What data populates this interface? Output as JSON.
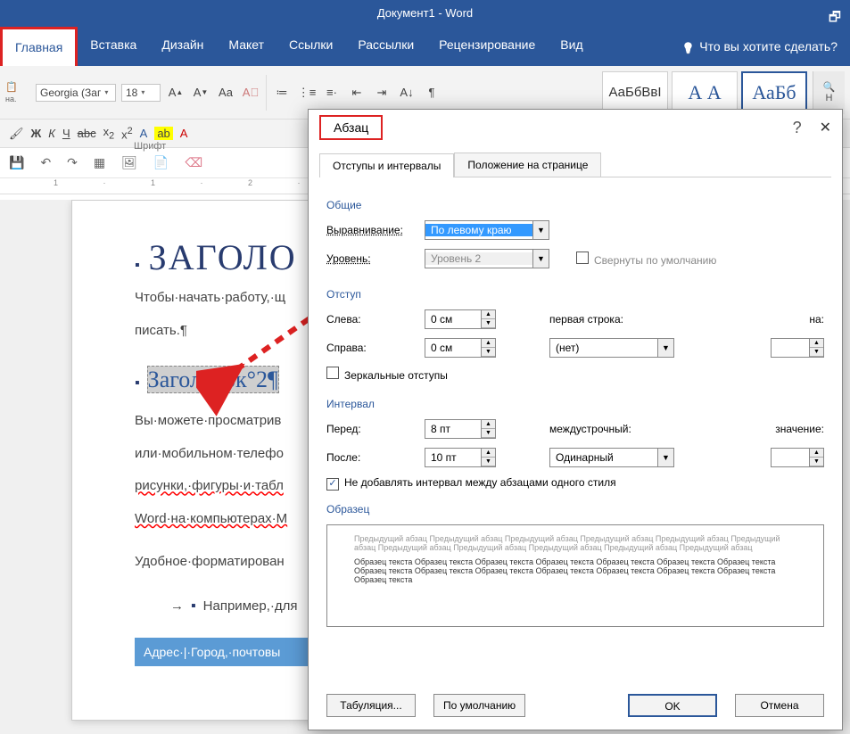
{
  "app": {
    "title": "Документ1 - Word"
  },
  "ribbon": {
    "tabs": [
      "Главная",
      "Вставка",
      "Дизайн",
      "Макет",
      "Ссылки",
      "Рассылки",
      "Рецензирование",
      "Вид"
    ],
    "tellme": "Что вы хотите сделать?",
    "font_name": "Georgia (Заг",
    "font_size": "18",
    "group_font": "Шрифт",
    "styles": {
      "normal": "АаБбВвІ",
      "h1": "А А",
      "h2": "АаБб"
    },
    "right": "Н"
  },
  "dialog": {
    "title": "Абзац",
    "tab1": "Отступы и интервалы",
    "tab2": "Положение на странице",
    "general": "Общие",
    "align_lbl": "Выравнивание:",
    "align_val": "По левому краю",
    "level_lbl": "Уровень:",
    "level_val": "Уровень 2",
    "collapse": "Свернуты по умолчанию",
    "indent": "Отступ",
    "left_lbl": "Слева:",
    "left_val": "0 см",
    "right_lbl": "Справа:",
    "right_val": "0 см",
    "firstline_lbl": "первая строка:",
    "firstline_val": "(нет)",
    "by_lbl": "на:",
    "mirror": "Зеркальные отступы",
    "spacing": "Интервал",
    "before_lbl": "Перед:",
    "before_val": "8 пт",
    "after_lbl": "После:",
    "after_val": "10 пт",
    "linesp_lbl": "междустрочный:",
    "linesp_val": "Одинарный",
    "val_lbl": "значение:",
    "nosame": "Не добавлять интервал между абзацами одного стиля",
    "preview_lbl": "Образец",
    "prev_prev": "Предыдущий абзац Предыдущий абзац Предыдущий абзац Предыдущий абзац Предыдущий абзац Предыдущий абзац Предыдущий абзац Предыдущий абзац Предыдущий абзац Предыдущий абзац Предыдущий абзац",
    "prev_cur": "Образец текста Образец текста Образец текста Образец текста Образец текста Образец текста Образец текста Образец текста Образец текста Образец текста Образец текста Образец текста Образец текста Образец текста Образец текста",
    "tabs_btn": "Табуляция...",
    "default_btn": "По умолчанию",
    "ok": "OK",
    "cancel": "Отмена"
  },
  "doc": {
    "title": "ЗАГОЛО",
    "p1": "Чтобы·начать·работу,·щ",
    "p1b": "писать.¶",
    "h2sel": "Заголовок°2¶",
    "p2a": "Вы·можете·просматрив",
    "p2b": "или·мобильном·телефо",
    "p2c": "рисунки,·фигуры·и·табл",
    "p2d": "Word·на·компьютерах·M",
    "p3": "Удобное·форматирован",
    "p4": "Например,·для",
    "addr": "Адрес·|·Город,·почтовы"
  }
}
